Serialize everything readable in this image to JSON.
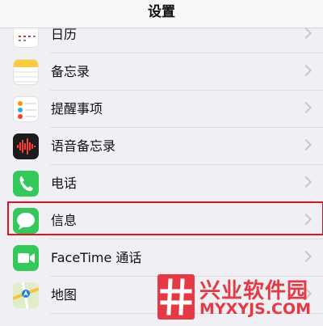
{
  "navbar": {
    "title": "设置"
  },
  "rows": [
    {
      "label": "日历",
      "icon": "calendar-icon"
    },
    {
      "label": "备忘录",
      "icon": "notes-icon"
    },
    {
      "label": "提醒事项",
      "icon": "reminders-icon"
    },
    {
      "label": "语音备忘录",
      "icon": "voice-memos-icon"
    },
    {
      "label": "电话",
      "icon": "phone-icon"
    },
    {
      "label": "信息",
      "icon": "messages-icon"
    },
    {
      "label": "FaceTime 通话",
      "icon": "facetime-icon"
    },
    {
      "label": "地图",
      "icon": "maps-icon"
    }
  ],
  "watermark": {
    "title": "兴业软件园",
    "url": "MYXYJS.COM"
  },
  "colors": {
    "highlight": "#e0141e",
    "watermark": "#e33a46",
    "green": "#34c759"
  }
}
